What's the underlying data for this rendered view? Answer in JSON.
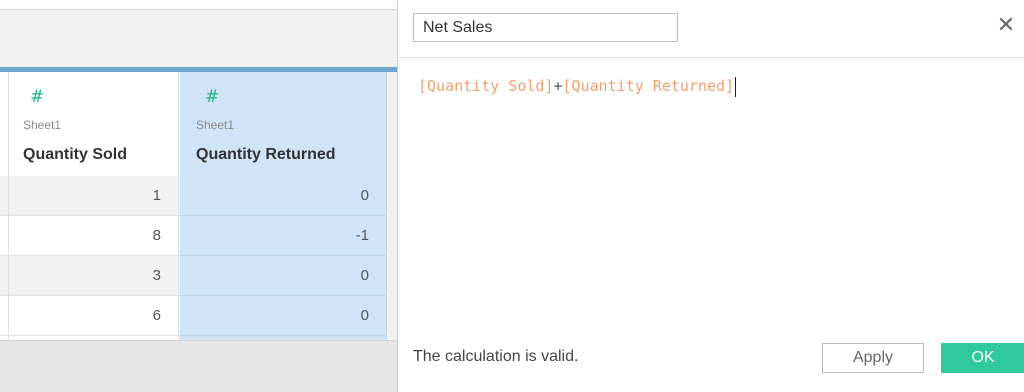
{
  "grid": {
    "columns": [
      {
        "icon": "number-hash-icon",
        "source": "Sheet1",
        "name": "Quantity Sold",
        "values": [
          "1",
          "8",
          "3",
          "6"
        ]
      },
      {
        "icon": "number-hash-icon",
        "source": "Sheet1",
        "name": "Quantity Returned",
        "values": [
          "0",
          "-1",
          "0",
          "0"
        ]
      }
    ]
  },
  "dialog": {
    "calc_name": "Net Sales",
    "close_icon": "close-icon",
    "formula": {
      "field1": "[Quantity Sold]",
      "operator": "+",
      "field2": "[Quantity Returned]"
    },
    "status": "The calculation is valid.",
    "apply_label": "Apply",
    "ok_label": "OK"
  },
  "colors": {
    "field_text": "#f0a070",
    "ok_button": "#2fc99b",
    "selected_column": "#cfe4f6",
    "number_icon": "#1fb37e"
  }
}
